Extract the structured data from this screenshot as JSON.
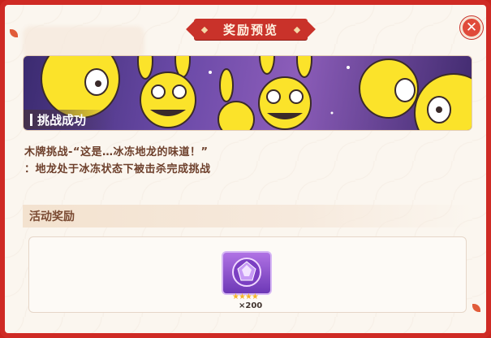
{
  "dialog": {
    "title": "奖励预览",
    "close_icon": "close-icon"
  },
  "banner": {
    "label": "挑战成功",
    "image_icon": "yellow-bunny-characters-illustration"
  },
  "description": {
    "line1": "木牌挑战-“这是…冰冻地龙的味道！”",
    "line2": "：地龙处于冰冻状态下被击杀完成挑战"
  },
  "rewards": {
    "section_title": "活动奖励",
    "items": [
      {
        "icon": "purple-gem-icon",
        "stars": "★★★★",
        "quantity": "×200"
      }
    ]
  },
  "colors": {
    "frame_red": "#cf2a24",
    "panel_bg": "#fbf6ef",
    "text_brown": "#6d3f2b"
  }
}
